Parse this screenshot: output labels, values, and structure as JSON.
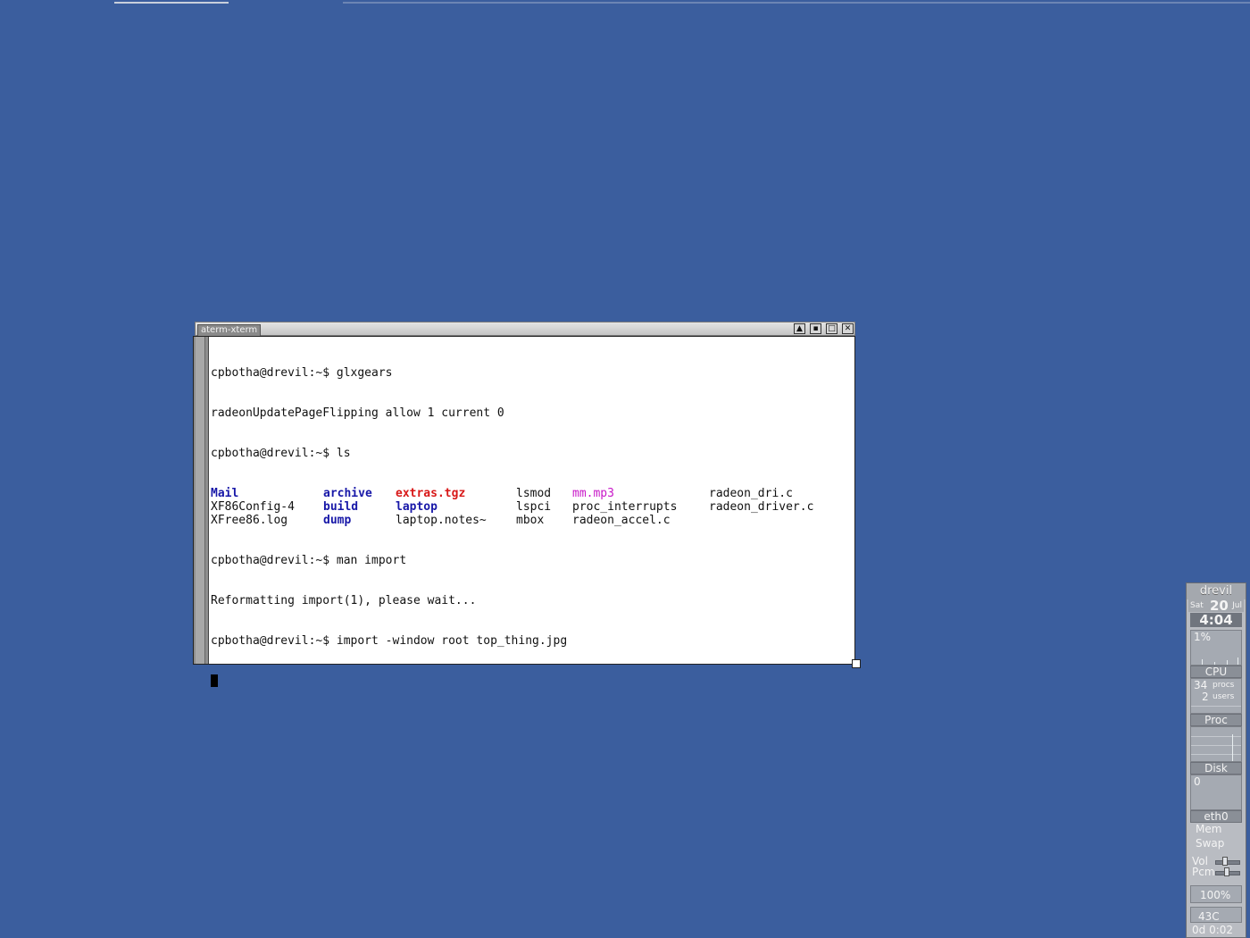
{
  "desktop": {
    "background_color": "#3b5e9e"
  },
  "terminal": {
    "title": "aterm-xterm",
    "buttons": {
      "shade": "▲",
      "iconify": "▪",
      "maximize": "□",
      "close": "✕"
    },
    "lines": [
      "cpbotha@drevil:~$ glxgears",
      "radeonUpdatePageFlipping allow 1 current 0",
      "cpbotha@drevil:~$ ls"
    ],
    "ls_rows": [
      [
        {
          "name": "Mail",
          "kind": "dir"
        },
        {
          "name": "archive",
          "kind": "dir"
        },
        {
          "name": "extras.tgz",
          "kind": "archive"
        },
        {
          "name": "lsmod",
          "kind": "file"
        },
        {
          "name": "mm.mp3",
          "kind": "media"
        },
        {
          "name": "radeon_dri.c",
          "kind": "file"
        }
      ],
      [
        {
          "name": "XF86Config-4",
          "kind": "file"
        },
        {
          "name": "build",
          "kind": "dir"
        },
        {
          "name": "laptop",
          "kind": "dir"
        },
        {
          "name": "lspci",
          "kind": "file"
        },
        {
          "name": "proc_interrupts",
          "kind": "file"
        },
        {
          "name": "radeon_driver.c",
          "kind": "file"
        }
      ],
      [
        {
          "name": "XFree86.log",
          "kind": "file"
        },
        {
          "name": "dump",
          "kind": "dir"
        },
        {
          "name": "laptop.notes~",
          "kind": "file"
        },
        {
          "name": "mbox",
          "kind": "file"
        },
        {
          "name": "radeon_accel.c",
          "kind": "file"
        },
        {
          "name": "",
          "kind": "file"
        }
      ]
    ],
    "lines_after": [
      "cpbotha@drevil:~$ man import",
      "Reformatting import(1), please wait...",
      "cpbotha@drevil:~$ import -window root top_thing.jpg"
    ]
  },
  "gkrellm": {
    "hostname": "drevil",
    "day": "Sat",
    "date": "20",
    "month": "Jul",
    "time": "4:04",
    "cpu_value": "1%",
    "cpu_label": "CPU",
    "procs_count": "34",
    "procs_label": "procs",
    "users_count": "2",
    "users_label": "users",
    "proc_label": "Proc",
    "disk_label": "Disk",
    "disk_value": "0",
    "net_label": "eth0",
    "mem_label": "Mem",
    "swap_label": "Swap",
    "vol_label": "Vol",
    "pcm_label": "Pcm",
    "battery_value": "100%",
    "temp_value": "43C",
    "uptime": "0d 0:02"
  }
}
